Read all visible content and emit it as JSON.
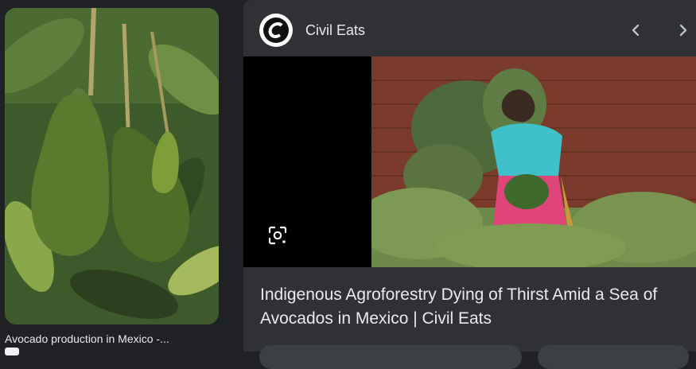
{
  "left_result": {
    "caption": "Avocado production in Mexico -..."
  },
  "preview_panel": {
    "source_name": "Civil Eats",
    "title": "Indigenous Agroforestry Dying of Thirst Amid a Sea of Avocados in Mexico | Civil Eats",
    "icons": {
      "prev": "chevron-left-icon",
      "next": "chevron-right-icon",
      "lens": "google-lens-icon"
    }
  },
  "colors": {
    "page_background": "#202124",
    "panel_background": "#303134",
    "text": "#e8eaed"
  }
}
